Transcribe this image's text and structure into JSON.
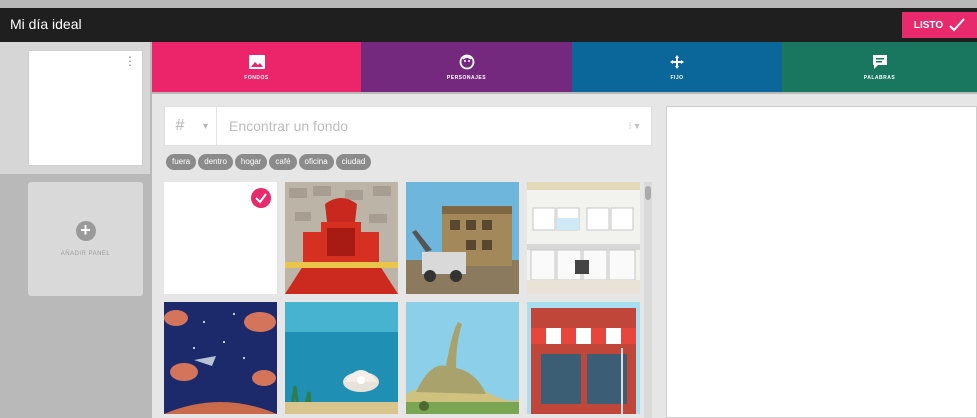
{
  "header": {
    "title": "Mi día ideal",
    "done_label": "LISTO"
  },
  "tabs": [
    {
      "id": "fondos",
      "label": "FONDOS",
      "icon": "image-icon",
      "color": "#ec2469"
    },
    {
      "id": "personajes",
      "label": "PERSONAJES",
      "icon": "character-icon",
      "color": "#74297f"
    },
    {
      "id": "fijo",
      "label": "FIJO",
      "icon": "move-icon",
      "color": "#0b679a"
    },
    {
      "id": "palabras",
      "label": "PALABRAS",
      "icon": "speech-bubble-icon",
      "color": "#19765f"
    }
  ],
  "sidebar": {
    "add_panel_label": "AÑADIR PANEL"
  },
  "search": {
    "hash": "#",
    "placeholder": "Encontrar un fondo"
  },
  "tags": [
    "fuera",
    "dentro",
    "hogar",
    "café",
    "oficina",
    "ciudad"
  ],
  "backgrounds": [
    {
      "name": "blank",
      "selected": true
    },
    {
      "name": "throne-room",
      "selected": false
    },
    {
      "name": "construction-site",
      "selected": false
    },
    {
      "name": "kitchen",
      "selected": false
    },
    {
      "name": "space",
      "selected": false
    },
    {
      "name": "underwater",
      "selected": false
    },
    {
      "name": "dinosaur-landscape",
      "selected": false
    },
    {
      "name": "storefront",
      "selected": false
    }
  ],
  "colors": {
    "accent": "#e8296b",
    "topbar": "#1f1f1f"
  }
}
